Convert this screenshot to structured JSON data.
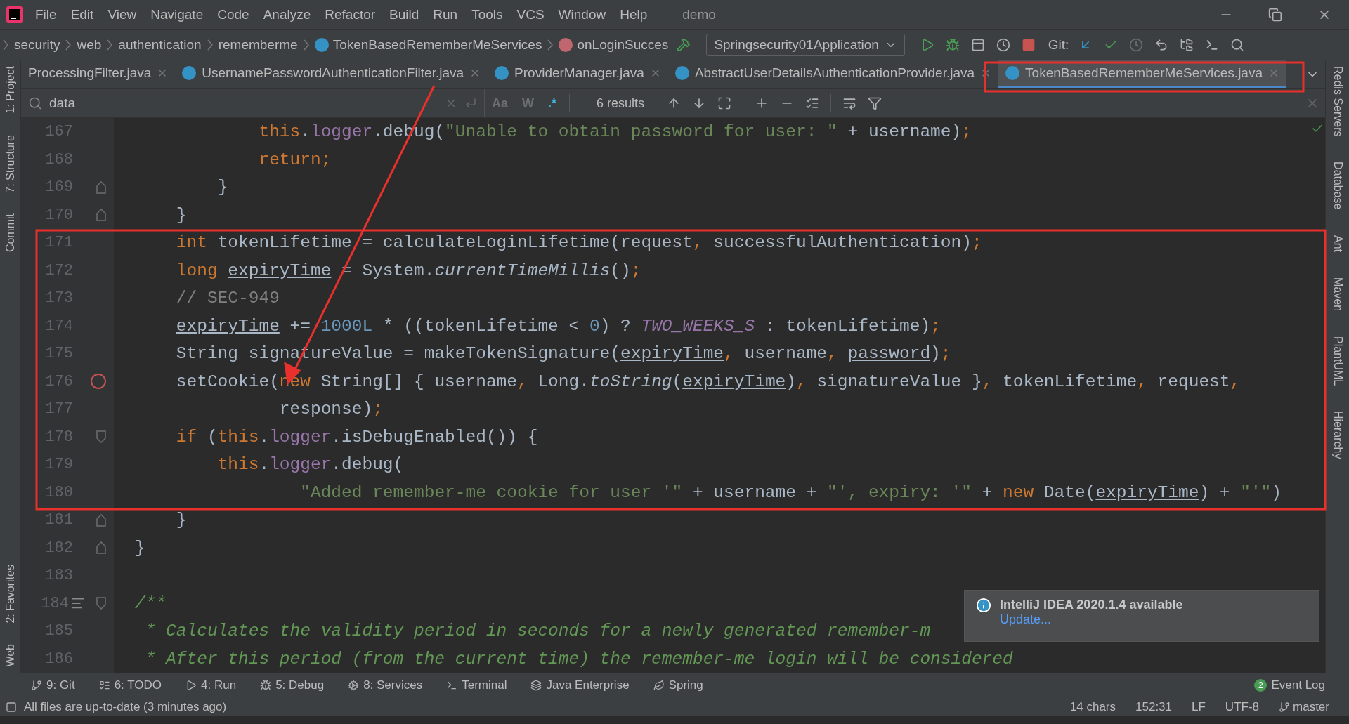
{
  "menu_bar": {
    "items": [
      "File",
      "Edit",
      "View",
      "Navigate",
      "Code",
      "Analyze",
      "Refactor",
      "Build",
      "Run",
      "Tools",
      "VCS",
      "Window",
      "Help"
    ],
    "title": "demo"
  },
  "nav_bar": {
    "breadcrumbs": [
      {
        "label": "security",
        "kind": "folder"
      },
      {
        "label": "web",
        "kind": "folder"
      },
      {
        "label": "authentication",
        "kind": "folder"
      },
      {
        "label": "rememberme",
        "kind": "folder"
      },
      {
        "label": "TokenBasedRememberMeServices",
        "kind": "class"
      },
      {
        "label": "onLoginSucces",
        "kind": "method"
      }
    ],
    "run_config": "Springsecurity01Application",
    "git_label": "Git:"
  },
  "tabs": [
    {
      "label": "ProcessingFilter.java",
      "selected": false,
      "icon": false
    },
    {
      "label": "UsernamePasswordAuthenticationFilter.java",
      "selected": false,
      "icon": true
    },
    {
      "label": "ProviderManager.java",
      "selected": false,
      "icon": true
    },
    {
      "label": "AbstractUserDetailsAuthenticationProvider.java",
      "selected": false,
      "icon": true
    },
    {
      "label": "TokenBasedRememberMeServices.java",
      "selected": true,
      "icon": true
    }
  ],
  "find_bar": {
    "query": "data",
    "options": [
      {
        "label": "Aa",
        "on": false
      },
      {
        "label": "W",
        "on": false
      },
      {
        "label": ".*",
        "on": true
      }
    ],
    "results": "6 results"
  },
  "left_tool_strip": {
    "top": [
      {
        "label": "1: Project"
      },
      {
        "label": "7: Structure"
      },
      {
        "label": "Commit"
      }
    ],
    "bottom": [
      {
        "label": "2: Favorites"
      },
      {
        "label": "Web"
      }
    ]
  },
  "right_tool_strip": [
    {
      "label": "Redis Servers"
    },
    {
      "label": "Database"
    },
    {
      "label": "Ant"
    },
    {
      "label": "Maven"
    },
    {
      "label": "PlantUML"
    },
    {
      "label": "Hierarchy"
    }
  ],
  "editor": {
    "lines": [
      {
        "number": "167",
        "tokens": [
          {
            "text": "            this",
            "kind": "keyword"
          },
          {
            "text": ".",
            "kind": "plain"
          },
          {
            "text": "logger",
            "kind": "field"
          },
          {
            "text": ".debug(",
            "kind": "plain"
          },
          {
            "text": "\"Unable to obtain password for user: \"",
            "kind": "string"
          },
          {
            "text": " + username)",
            "kind": "plain"
          },
          {
            "text": ";",
            "kind": "keyword"
          }
        ]
      },
      {
        "number": "168",
        "tokens": [
          {
            "text": "            return;",
            "kind": "keyword"
          }
        ]
      },
      {
        "number": "169",
        "markers": [
          {
            "kind": "fold-end"
          }
        ],
        "tokens": [
          {
            "text": "        }",
            "kind": "plain"
          }
        ]
      },
      {
        "number": "170",
        "markers": [
          {
            "kind": "fold-end"
          }
        ],
        "tokens": [
          {
            "text": "    }",
            "kind": "plain"
          }
        ]
      },
      {
        "number": "171",
        "tokens": [
          {
            "text": "    int",
            "kind": "keyword"
          },
          {
            "text": " tokenLifetime = calculateLoginLifetime(request",
            "kind": "plain"
          },
          {
            "text": ", ",
            "kind": "keyword"
          },
          {
            "text": "successfulAuthentication)",
            "kind": "plain"
          },
          {
            "text": ";",
            "kind": "keyword"
          }
        ]
      },
      {
        "number": "172",
        "tokens": [
          {
            "text": "    long ",
            "kind": "keyword"
          },
          {
            "text": "expiryTime",
            "kind": "reassigned"
          },
          {
            "text": " = System.",
            "kind": "plain"
          },
          {
            "text": "currentTimeMillis",
            "kind": "static"
          },
          {
            "text": "()",
            "kind": "plain"
          },
          {
            "text": ";",
            "kind": "keyword"
          }
        ]
      },
      {
        "number": "173",
        "tokens": [
          {
            "text": "    // SEC-949",
            "kind": "comment"
          }
        ]
      },
      {
        "number": "174",
        "tokens": [
          {
            "text": "    expiryTime",
            "kind": "reassigned"
          },
          {
            "text": " += ",
            "kind": "plain"
          },
          {
            "text": "1000L",
            "kind": "number"
          },
          {
            "text": " * ((tokenLifetime < ",
            "kind": "plain"
          },
          {
            "text": "0",
            "kind": "number"
          },
          {
            "text": ") ? ",
            "kind": "plain"
          },
          {
            "text": "TWO_WEEKS_S",
            "kind": "constant"
          },
          {
            "text": " : tokenLifetime)",
            "kind": "plain"
          },
          {
            "text": ";",
            "kind": "keyword"
          }
        ]
      },
      {
        "number": "175",
        "tokens": [
          {
            "text": "    String signatureValue = makeTokenSignature(",
            "kind": "plain"
          },
          {
            "text": "expiryTime",
            "kind": "reassigned"
          },
          {
            "text": ", ",
            "kind": "keyword"
          },
          {
            "text": "username",
            "kind": "plain"
          },
          {
            "text": ", ",
            "kind": "keyword"
          },
          {
            "text": "password",
            "kind": "reassigned"
          },
          {
            "text": ")",
            "kind": "plain"
          },
          {
            "text": ";",
            "kind": "keyword"
          }
        ]
      },
      {
        "number": "176",
        "markers": [
          {
            "kind": "breakpoint"
          }
        ],
        "tokens": [
          {
            "text": "    setCookie(",
            "kind": "plain"
          },
          {
            "text": "new",
            "kind": "keyword"
          },
          {
            "text": " String[] { username",
            "kind": "plain"
          },
          {
            "text": ", ",
            "kind": "keyword"
          },
          {
            "text": "Long.",
            "kind": "plain"
          },
          {
            "text": "toString",
            "kind": "static"
          },
          {
            "text": "(",
            "kind": "plain"
          },
          {
            "text": "expiryTime",
            "kind": "reassigned"
          },
          {
            "text": ")",
            "kind": "plain"
          },
          {
            "text": ", ",
            "kind": "keyword"
          },
          {
            "text": "signatureValue }",
            "kind": "plain"
          },
          {
            "text": ", ",
            "kind": "keyword"
          },
          {
            "text": "tokenLifetime",
            "kind": "plain"
          },
          {
            "text": ", ",
            "kind": "keyword"
          },
          {
            "text": "request",
            "kind": "plain"
          },
          {
            "text": ",",
            "kind": "keyword"
          }
        ]
      },
      {
        "number": "177",
        "tokens": [
          {
            "text": "              response)",
            "kind": "plain"
          },
          {
            "text": ";",
            "kind": "keyword"
          }
        ]
      },
      {
        "number": "178",
        "markers": [
          {
            "kind": "fold-start"
          }
        ],
        "tokens": [
          {
            "text": "    if",
            "kind": "keyword"
          },
          {
            "text": " (",
            "kind": "plain"
          },
          {
            "text": "this",
            "kind": "keyword"
          },
          {
            "text": ".",
            "kind": "plain"
          },
          {
            "text": "logger",
            "kind": "field"
          },
          {
            "text": ".isDebugEnabled()) {",
            "kind": "plain"
          }
        ]
      },
      {
        "number": "179",
        "tokens": [
          {
            "text": "        this",
            "kind": "keyword"
          },
          {
            "text": ".",
            "kind": "plain"
          },
          {
            "text": "logger",
            "kind": "field"
          },
          {
            "text": ".debug(",
            "kind": "plain"
          }
        ]
      },
      {
        "number": "180",
        "tokens": [
          {
            "text": "                \"Added remember-me cookie for user '\"",
            "kind": "string"
          },
          {
            "text": " + username + ",
            "kind": "plain"
          },
          {
            "text": "\"', expiry: '\"",
            "kind": "string"
          },
          {
            "text": " + ",
            "kind": "plain"
          },
          {
            "text": "new",
            "kind": "keyword"
          },
          {
            "text": " Date(",
            "kind": "plain"
          },
          {
            "text": "expiryTime",
            "kind": "reassigned"
          },
          {
            "text": ") + ",
            "kind": "plain"
          },
          {
            "text": "\"'\"",
            "kind": "string"
          },
          {
            "text": ")",
            "kind": "plain"
          }
        ]
      },
      {
        "number": "181",
        "markers": [
          {
            "kind": "fold-end"
          }
        ],
        "tokens": [
          {
            "text": "    }",
            "kind": "plain"
          }
        ]
      },
      {
        "number": "182",
        "markers": [
          {
            "kind": "fold-end"
          }
        ],
        "tokens": [
          {
            "text": "}",
            "kind": "plain"
          }
        ]
      },
      {
        "number": "183"
      },
      {
        "number": "184",
        "markers": [
          {
            "kind": "doc"
          },
          {
            "kind": "fold-start"
          }
        ],
        "tokens": [
          {
            "text": "/**",
            "kind": "doc"
          }
        ]
      },
      {
        "number": "185",
        "tokens": [
          {
            "text": " * Calculates the validity period in seconds for a newly generated remember-m",
            "kind": "doc"
          }
        ]
      },
      {
        "number": "186",
        "tokens": [
          {
            "text": " * After this period (from the current time) the remember-me login will be considered",
            "kind": "doc"
          }
        ]
      }
    ]
  },
  "notification": {
    "title": "IntelliJ IDEA 2020.1.4 available",
    "link": "Update..."
  },
  "tool_window_bar": {
    "items": [
      {
        "label": "9: Git",
        "kind": "git"
      },
      {
        "label": "6: TODO",
        "kind": "todo"
      },
      {
        "label": "4: Run",
        "kind": "run"
      },
      {
        "label": "5: Debug",
        "kind": "debug"
      },
      {
        "label": "8: Services",
        "kind": "services"
      },
      {
        "label": "Terminal",
        "kind": "terminal"
      },
      {
        "label": "Java Enterprise",
        "kind": "enterprise"
      },
      {
        "label": "Spring",
        "kind": "spring"
      }
    ],
    "event_log": {
      "badge": "2",
      "label": "Event Log"
    }
  },
  "status_bar": {
    "message": "All files are up-to-date (3 minutes ago)",
    "items": [
      "14 chars",
      "152:31",
      "LF",
      "UTF-8"
    ],
    "branch": "master"
  }
}
